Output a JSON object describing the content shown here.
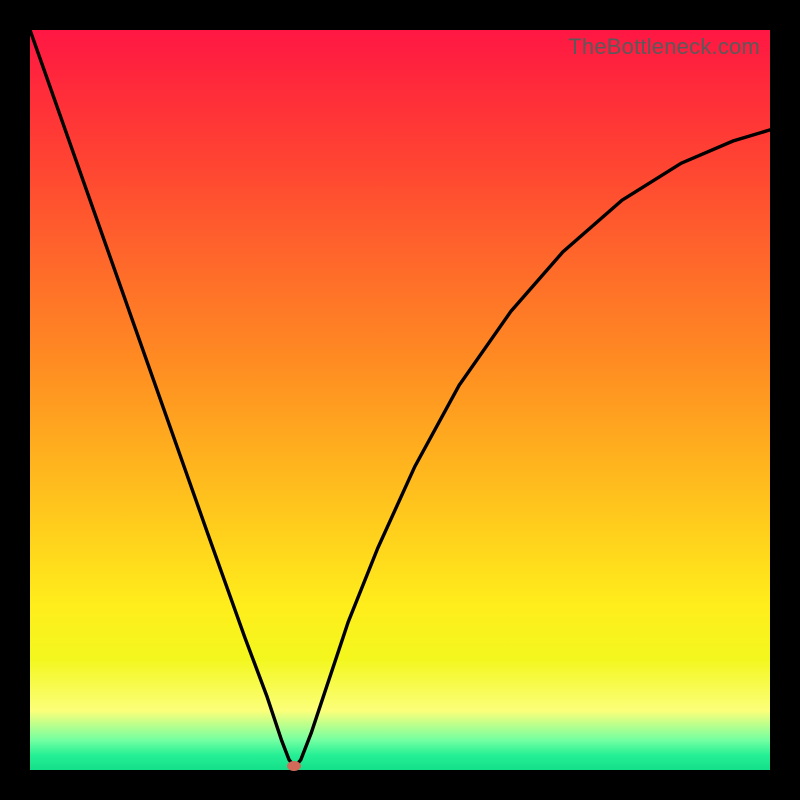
{
  "watermark": "TheBottleneck.com",
  "chart_data": {
    "type": "line",
    "title": "",
    "xlabel": "",
    "ylabel": "",
    "x_range": [
      0,
      1
    ],
    "y_range": [
      0,
      1
    ],
    "marker": {
      "x_frac": 0.357,
      "y_frac": 0.995
    },
    "series": [
      {
        "name": "curve",
        "points": [
          {
            "x_frac": 0.0,
            "y_frac": 0.0
          },
          {
            "x_frac": 0.06,
            "y_frac": 0.17
          },
          {
            "x_frac": 0.12,
            "y_frac": 0.34
          },
          {
            "x_frac": 0.18,
            "y_frac": 0.51
          },
          {
            "x_frac": 0.24,
            "y_frac": 0.68
          },
          {
            "x_frac": 0.29,
            "y_frac": 0.82
          },
          {
            "x_frac": 0.32,
            "y_frac": 0.9
          },
          {
            "x_frac": 0.34,
            "y_frac": 0.96
          },
          {
            "x_frac": 0.35,
            "y_frac": 0.986
          },
          {
            "x_frac": 0.358,
            "y_frac": 0.996
          },
          {
            "x_frac": 0.366,
            "y_frac": 0.986
          },
          {
            "x_frac": 0.38,
            "y_frac": 0.95
          },
          {
            "x_frac": 0.4,
            "y_frac": 0.89
          },
          {
            "x_frac": 0.43,
            "y_frac": 0.8
          },
          {
            "x_frac": 0.47,
            "y_frac": 0.7
          },
          {
            "x_frac": 0.52,
            "y_frac": 0.59
          },
          {
            "x_frac": 0.58,
            "y_frac": 0.48
          },
          {
            "x_frac": 0.65,
            "y_frac": 0.38
          },
          {
            "x_frac": 0.72,
            "y_frac": 0.3
          },
          {
            "x_frac": 0.8,
            "y_frac": 0.23
          },
          {
            "x_frac": 0.88,
            "y_frac": 0.18
          },
          {
            "x_frac": 0.95,
            "y_frac": 0.15
          },
          {
            "x_frac": 1.0,
            "y_frac": 0.135
          }
        ]
      }
    ]
  }
}
